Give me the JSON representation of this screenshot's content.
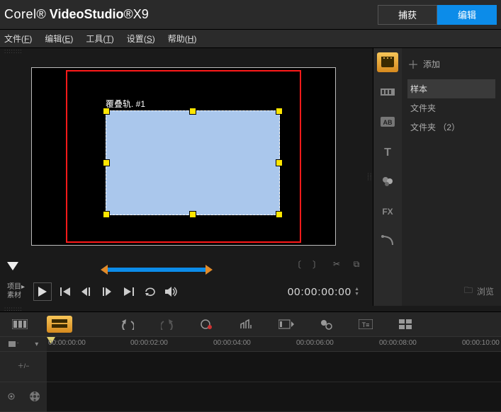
{
  "app": {
    "brand": "Corel",
    "product": "VideoStudio",
    "version": "X9"
  },
  "topTabs": {
    "capture": "捕获",
    "edit": "编辑"
  },
  "menu": {
    "file": "文件",
    "file_hk": "F",
    "edit": "编辑",
    "edit_hk": "E",
    "tools": "工具",
    "tools_hk": "T",
    "settings": "设置",
    "settings_hk": "S",
    "help": "帮助",
    "help_hk": "H"
  },
  "preview": {
    "overlayLabel": "覆叠轨. #1",
    "modeProject": "项目",
    "modeClip": "素材",
    "timecode": "00:00:00:00"
  },
  "library": {
    "add": "添加",
    "items": [
      "样本",
      "文件夹",
      "文件夹 （2）"
    ],
    "browse": "浏览"
  },
  "timeline": {
    "ticks": [
      "00:00:00:00",
      "00:00:02:00",
      "00:00:04:00",
      "00:00:06:00",
      "00:00:08:00",
      "00:00:10:00"
    ]
  }
}
